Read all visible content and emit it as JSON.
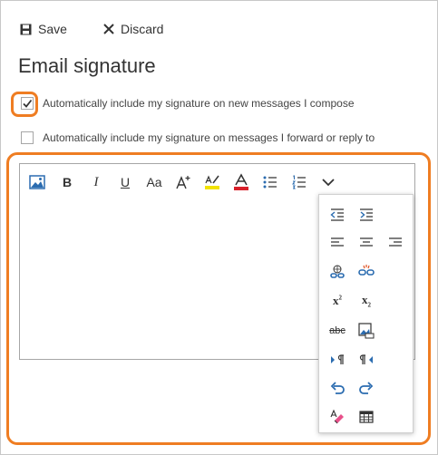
{
  "toolbar": {
    "save_label": "Save",
    "discard_label": "Discard"
  },
  "page": {
    "title": "Email signature"
  },
  "options": [
    {
      "label": "Automatically include my signature on new messages I compose",
      "checked": true
    },
    {
      "label": "Automatically include my signature on messages I forward or reply to",
      "checked": false
    }
  ],
  "editor": {
    "format_buttons": {
      "bold": "B",
      "italic": "I",
      "underline": "U",
      "font": "Aa",
      "subscript_base": "x",
      "superscript_base": "x",
      "strike": "abc"
    }
  },
  "colors": {
    "highlight_outline": "#ef7d22",
    "accent_blue": "#2b6cb0",
    "font_color_bar": "#d8202a",
    "highlight_bar": "#f2e200"
  }
}
